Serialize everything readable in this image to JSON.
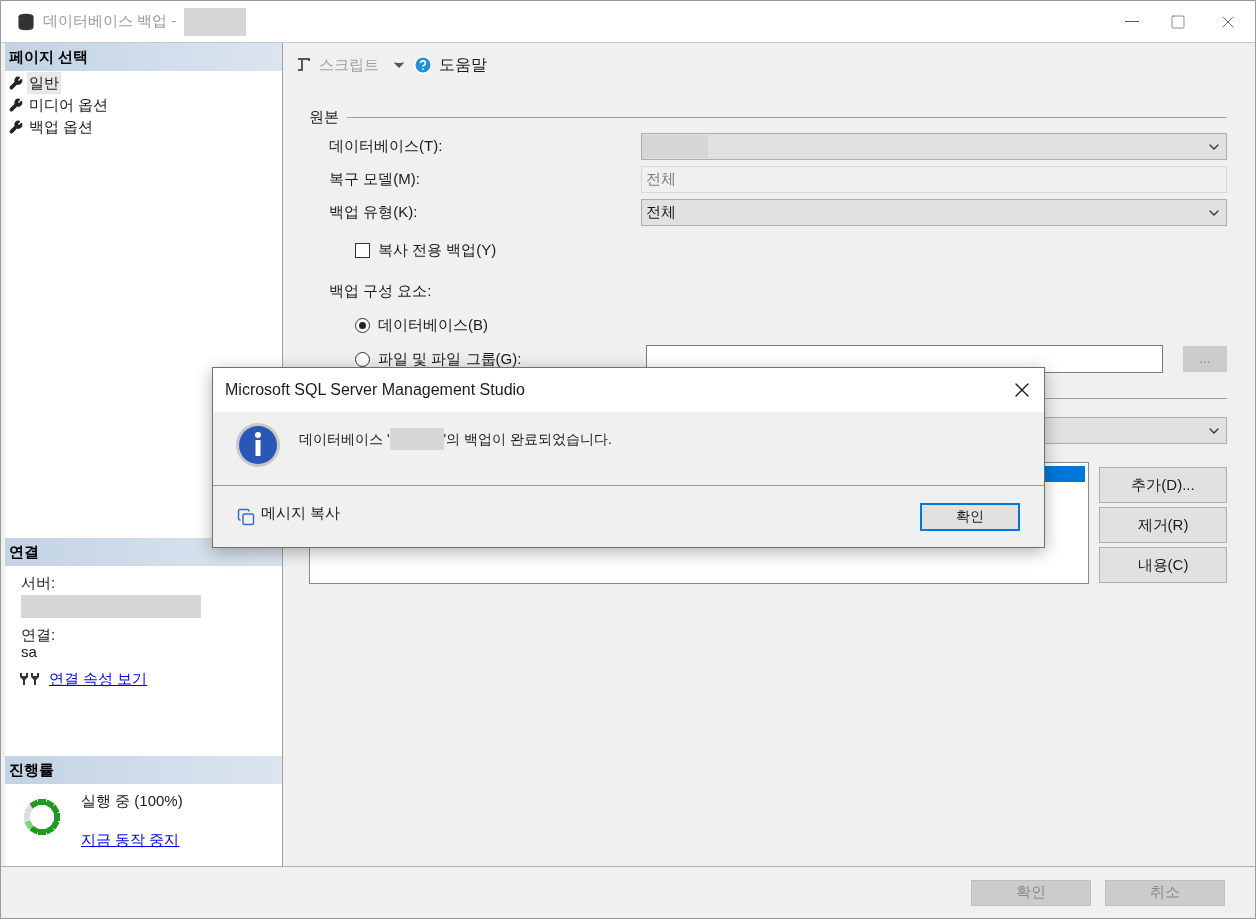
{
  "window": {
    "title": "데이터베이스 백업 -"
  },
  "sidebar": {
    "page_select": {
      "title": "페이지 선택",
      "items": [
        {
          "label": "일반",
          "selected": true
        },
        {
          "label": "미디어 옵션",
          "selected": false
        },
        {
          "label": "백업 옵션",
          "selected": false
        }
      ]
    },
    "connection": {
      "title": "연결",
      "server_label": "서버:",
      "connection_label": "연결:",
      "connection_value": "sa",
      "link": "연결 속성 보기"
    },
    "progress": {
      "title": "진행률",
      "status": "실행 중 (100%)",
      "link": "지금 동작 중지"
    }
  },
  "toolbar": {
    "script": {
      "label": "스크립트",
      "disabled": true
    },
    "help": {
      "label": "도움말"
    }
  },
  "source": {
    "title": "원본",
    "database_label": "데이터베이스(T):",
    "recovery_label": "복구 모델(M):",
    "recovery_value": "전체",
    "backup_type_label": "백업 유형(K):",
    "backup_type_value": "전체",
    "copy_only": {
      "label": "복사 전용 백업(Y)",
      "checked": false
    },
    "components_label": "백업 구성 요소:",
    "components": [
      {
        "label": "데이터베이스(B)",
        "selected": true
      },
      {
        "label": "파일 및 파일 그룹(G):",
        "selected": false
      }
    ],
    "browse": "..."
  },
  "destination": {
    "buttons": [
      "추가(D)...",
      "제거(R)",
      "내용(C)"
    ]
  },
  "footer": {
    "buttons": [
      {
        "label": "확인",
        "disabled": true
      },
      {
        "label": "취소",
        "disabled": true
      }
    ]
  },
  "dialog": {
    "title": "Microsoft SQL Server Management Studio",
    "message_before": "데이터베이스 '",
    "message_after": "'의 백업이 완료되었습니다.",
    "copy": "메시지 복사",
    "ok": "확인"
  }
}
